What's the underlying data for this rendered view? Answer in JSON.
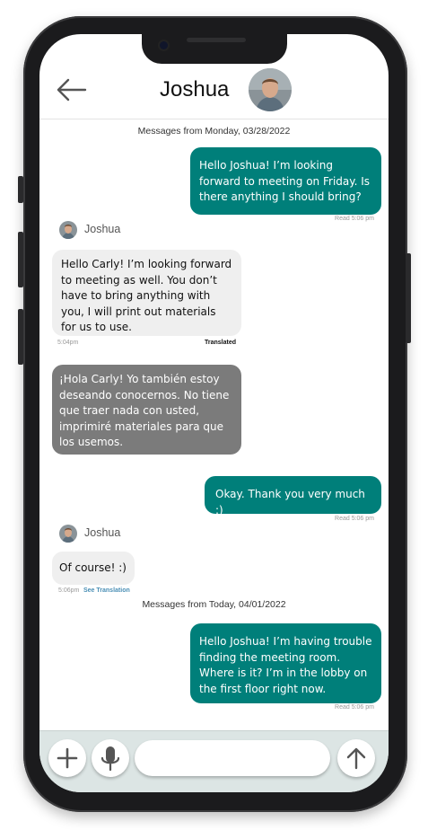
{
  "header": {
    "contact_name": "Joshua",
    "back_icon": "arrow-left-icon",
    "avatar_icon": "contact-avatar"
  },
  "conversation": {
    "date_separators": [
      "Messages from Monday, 03/28/2022",
      "Messages from Today, 04/01/2022"
    ],
    "messages": [
      {
        "direction": "outgoing",
        "text": "Hello Joshua! I’m looking forward to meeting on Friday. Is there anything I should bring?",
        "status": "Read 5:06 pm"
      },
      {
        "direction": "incoming",
        "sender": "Joshua",
        "text": "Hello Carly! I’m looking forward to meeting as well. You don’t have to bring anything with you, I will print out materials for us to use.",
        "time": "5:04pm",
        "translation_label": "Translated",
        "original_text": "¡Hola Carly! Yo también estoy deseando conocernos. No tiene que traer nada con usted, imprimiré materiales para que los usemos."
      },
      {
        "direction": "outgoing",
        "text": "Okay. Thank you very much :)",
        "status": "Read 5:06 pm"
      },
      {
        "direction": "incoming",
        "sender": "Joshua",
        "text": "Of course! :)",
        "time": "5:06pm",
        "translation_link": "See Translation"
      },
      {
        "direction": "outgoing",
        "text": "Hello Joshua! I’m having trouble finding the meeting room. Where is it? I’m in the lobby on the first floor right now.",
        "status": "Read 5:06 pm"
      }
    ]
  },
  "composer": {
    "add_icon": "plus-icon",
    "mic_icon": "microphone-icon",
    "send_icon": "arrow-up-icon",
    "input_value": "",
    "input_placeholder": ""
  },
  "colors": {
    "outgoing_bubble": "#007f7a",
    "incoming_bubble": "#efefef",
    "original_bubble": "#7b7b7b",
    "composer_bar": "#dce5e4",
    "link": "#4a8fb5"
  }
}
